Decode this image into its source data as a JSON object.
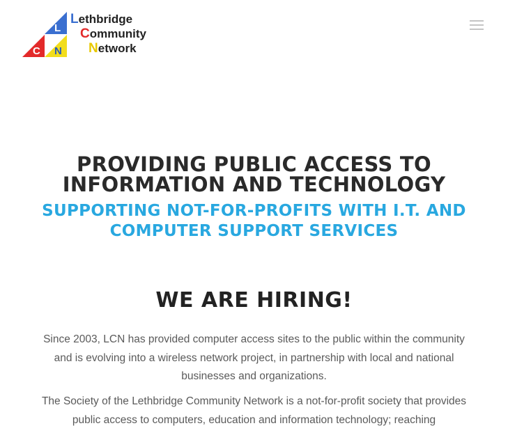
{
  "header": {
    "logo": {
      "mark_letters": [
        "L",
        "C",
        "N"
      ],
      "line1_initial": "L",
      "line1_rest": "ethbridge",
      "line2_initial": "C",
      "line2_rest": "ommunity",
      "line3_initial": "N",
      "line3_rest": "etwork",
      "colors": {
        "blue": "#3a6fd0",
        "red": "#e32a2a",
        "yellow": "#f2dd1c",
        "text": "#222222"
      }
    },
    "menu_icon": "hamburger-icon"
  },
  "hero": {
    "title_line1": "PROVIDING PUBLIC ACCESS TO",
    "title_line2": "INFORMATION AND TECHNOLOGY",
    "subtitle_line1": "SUPPORTING NOT-FOR-PROFITS WITH I.T. AND",
    "subtitle_line2": "COMPUTER SUPPORT SERVICES",
    "accent_color": "#29a8e0"
  },
  "content": {
    "heading": "WE ARE HIRING!",
    "paragraph1": "Since 2003, LCN has provided computer access sites to the public within the community and is evolving into a wireless network project, in partnership with local and national businesses and organizations.",
    "paragraph2": "The Society of the Lethbridge Community Network is a not-for-profit society that provides public access to computers, education and information technology; reaching"
  }
}
